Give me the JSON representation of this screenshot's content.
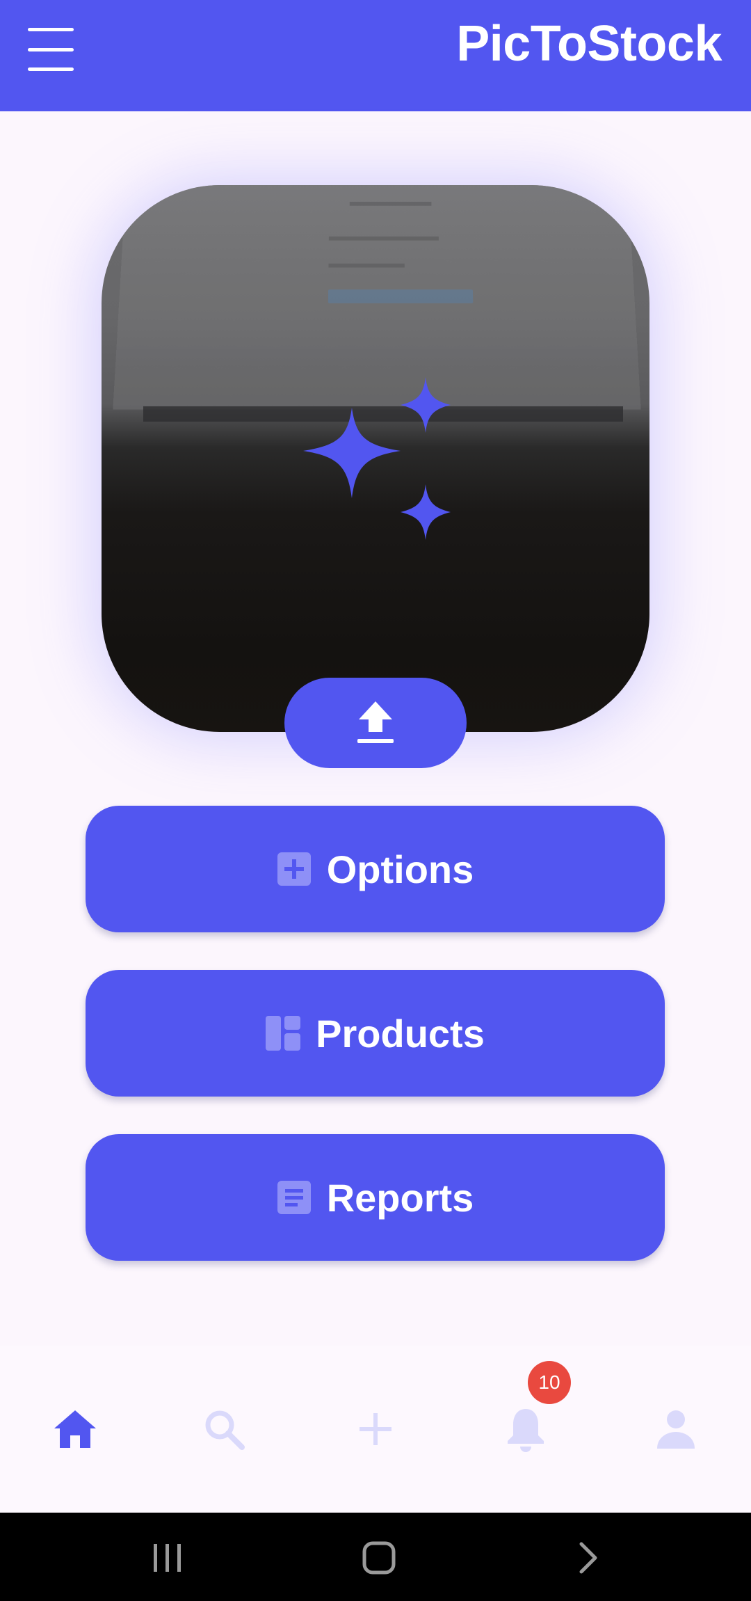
{
  "app": {
    "title": "PicToStock",
    "accent_color": "#5256f0"
  },
  "header": {
    "menu_icon": "hamburger-menu-icon"
  },
  "image_card": {
    "overlay_icon": "sparkles-icon",
    "upload_icon": "upload-icon"
  },
  "actions": [
    {
      "label": "Options",
      "icon": "add-box-icon"
    },
    {
      "label": "Products",
      "icon": "dashboard-icon"
    },
    {
      "label": "Reports",
      "icon": "article-icon"
    }
  ],
  "bottom_nav": {
    "items": [
      {
        "name": "home",
        "icon": "home-icon",
        "active": true
      },
      {
        "name": "search",
        "icon": "search-icon",
        "active": false
      },
      {
        "name": "add",
        "icon": "plus-icon",
        "active": false
      },
      {
        "name": "notifications",
        "icon": "bell-icon",
        "active": false,
        "badge": "10"
      },
      {
        "name": "profile",
        "icon": "person-icon",
        "active": false
      }
    ]
  },
  "system_nav": {
    "recents_icon": "recents-icon",
    "home_icon": "home-square-icon",
    "back_icon": "back-chevron-icon"
  }
}
